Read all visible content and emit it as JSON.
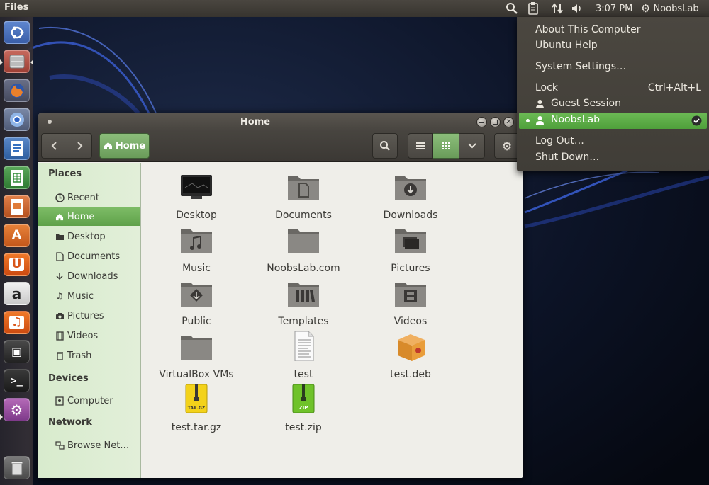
{
  "top_panel": {
    "app_title": "Files",
    "clock": "3:07 PM",
    "user": "NoobsLab",
    "icons": [
      "search-icon",
      "clipboard-icon",
      "network-icon",
      "volume-icon",
      "gear-icon"
    ]
  },
  "launcher": {
    "items": [
      "ubuntu-dash",
      "files",
      "firefox",
      "chromium",
      "writer",
      "calc",
      "impress",
      "software-center",
      "ubuntu-one",
      "amazon",
      "ubuntu-one-music",
      "steam",
      "terminal",
      "system-settings",
      "trash"
    ]
  },
  "window": {
    "title": "Home",
    "breadcrumb_home": "Home"
  },
  "sidebar": {
    "places_heading": "Places",
    "places": [
      {
        "label": "Recent",
        "icon": "clock-icon"
      },
      {
        "label": "Home",
        "icon": "home-icon"
      },
      {
        "label": "Desktop",
        "icon": "desktop-folder-icon"
      },
      {
        "label": "Documents",
        "icon": "document-icon"
      },
      {
        "label": "Downloads",
        "icon": "download-icon"
      },
      {
        "label": "Music",
        "icon": "music-icon"
      },
      {
        "label": "Pictures",
        "icon": "camera-icon"
      },
      {
        "label": "Videos",
        "icon": "film-icon"
      },
      {
        "label": "Trash",
        "icon": "trash-icon"
      }
    ],
    "devices_heading": "Devices",
    "devices": [
      {
        "label": "Computer",
        "icon": "drive-icon"
      }
    ],
    "network_heading": "Network",
    "network": [
      {
        "label": "Browse Net…",
        "icon": "network-icon"
      }
    ]
  },
  "files": [
    {
      "name": "Desktop",
      "icon": "desktop-folder-icon"
    },
    {
      "name": "Documents",
      "icon": "documents-folder-icon"
    },
    {
      "name": "Downloads",
      "icon": "downloads-folder-icon"
    },
    {
      "name": "Music",
      "icon": "music-folder-icon"
    },
    {
      "name": "NoobsLab.com",
      "icon": "folder-icon"
    },
    {
      "name": "Pictures",
      "icon": "pictures-folder-icon"
    },
    {
      "name": "Public",
      "icon": "public-folder-icon"
    },
    {
      "name": "Templates",
      "icon": "templates-folder-icon"
    },
    {
      "name": "Videos",
      "icon": "videos-folder-icon"
    },
    {
      "name": "VirtualBox VMs",
      "icon": "folder-icon"
    },
    {
      "name": "test",
      "icon": "text-file-icon"
    },
    {
      "name": "test.deb",
      "icon": "package-icon"
    },
    {
      "name": "test.tar.gz",
      "icon": "tar-archive-icon",
      "badge": "TAR.GZ"
    },
    {
      "name": "test.zip",
      "icon": "zip-archive-icon",
      "badge": "ZIP"
    }
  ],
  "session_menu": {
    "about": "About This Computer",
    "help": "Ubuntu Help",
    "settings": "System Settings…",
    "lock": "Lock",
    "lock_shortcut": "Ctrl+Alt+L",
    "guest": "Guest Session",
    "current_user": "NoobsLab",
    "logout": "Log Out…",
    "shutdown": "Shut Down…"
  },
  "colors": {
    "accent_green": "#6cba55",
    "panel_dark": "#3d3a35",
    "sidebar_bg": "#dcebd2"
  }
}
